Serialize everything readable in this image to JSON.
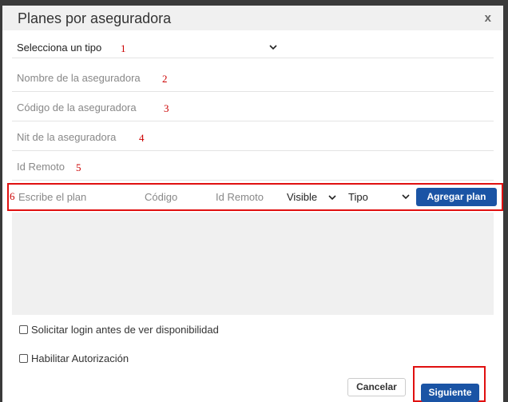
{
  "modal": {
    "title": "Planes por aseguradora",
    "close_label": "x"
  },
  "form": {
    "tipo_select": {
      "value": "Selecciona un tipo",
      "marker": "1"
    },
    "nombre": {
      "placeholder": "Nombre de la aseguradora",
      "marker": "2"
    },
    "codigo": {
      "placeholder": "Código de la aseguradora",
      "marker": "3"
    },
    "nit": {
      "placeholder": "Nit de la aseguradora",
      "marker": "4"
    },
    "id_remoto": {
      "placeholder": "Id Remoto",
      "marker": "5"
    }
  },
  "plan_row": {
    "marker": "6",
    "plan_placeholder": "Escribe el plan",
    "codigo_placeholder": "Código",
    "id_remoto_placeholder": "Id Remoto",
    "visible_select": "Visible",
    "tipo_select": "Tipo",
    "add_button": "Agregar plan"
  },
  "options": {
    "login_checkbox": "Solicitar login antes de ver disponibilidad",
    "auth_checkbox": "Habilitar Autorización"
  },
  "footer": {
    "cancel": "Cancelar",
    "next": "Siguiente"
  },
  "colors": {
    "primary": "#1a54a5",
    "annotation": "#e01010"
  }
}
